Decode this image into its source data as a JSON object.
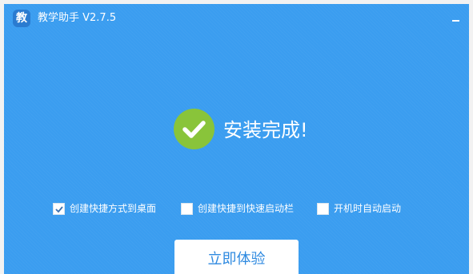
{
  "app": {
    "logo_char": "教",
    "title": "教学助手 V2.7.5"
  },
  "status": {
    "text": "安装完成!"
  },
  "options": [
    {
      "label": "创建快捷方式到桌面",
      "checked": true
    },
    {
      "label": "创建快捷到快速启动栏",
      "checked": false
    },
    {
      "label": "开机时自动启动",
      "checked": false
    }
  ],
  "actions": {
    "start_label": "立即体验"
  },
  "colors": {
    "window_bg": "#3a9df0",
    "success_green": "#89c43a",
    "button_text": "#2f8ae0"
  }
}
